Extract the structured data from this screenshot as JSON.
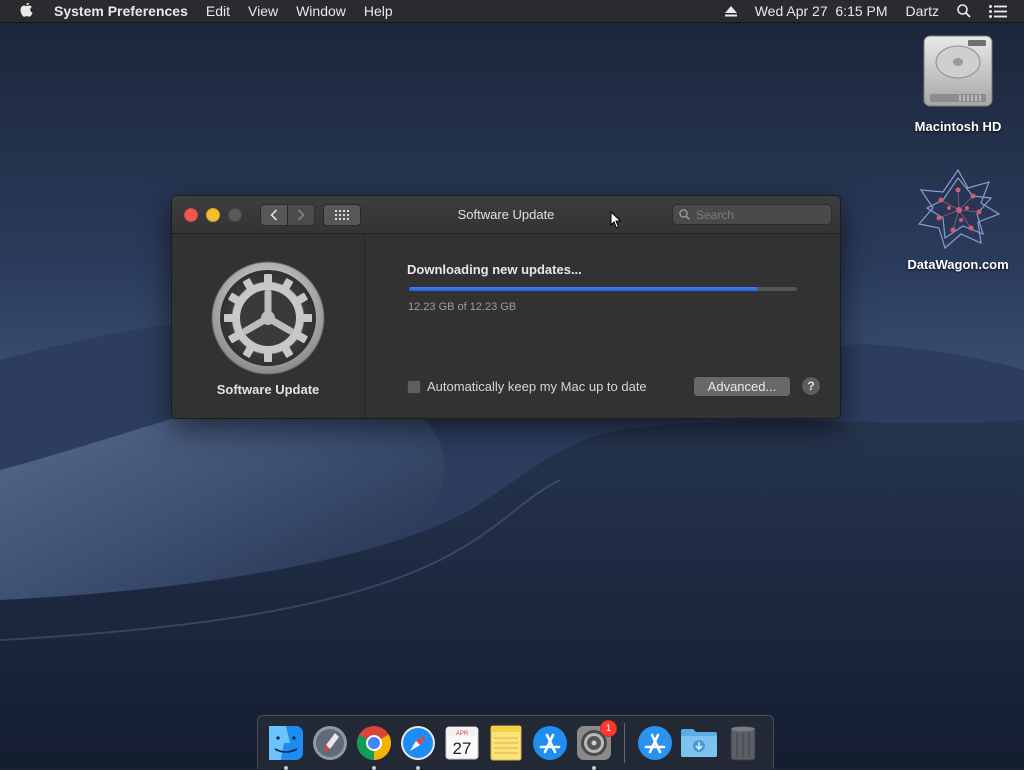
{
  "menubar": {
    "app_name": "System Preferences",
    "menus": [
      "Edit",
      "View",
      "Window",
      "Help"
    ],
    "datetime": "Wed Apr 27  6:15 PM",
    "user": "Dartz"
  },
  "desktop": {
    "icons": [
      {
        "label": "Macintosh HD"
      },
      {
        "label": "DataWagon.com"
      }
    ]
  },
  "window": {
    "title": "Software Update",
    "search_placeholder": "Search",
    "sidebar_label": "Software Update",
    "status": "Downloading new updates...",
    "progress_fraction": 0.9,
    "size_text": "12.23 GB of 12.23 GB",
    "auto_update_label": "Automatically keep my Mac up to date",
    "auto_update_checked": false,
    "advanced_label": "Advanced...",
    "help_label": "?"
  },
  "dock": {
    "calendar_month": "APR",
    "calendar_day": "27",
    "sysprefs_badge": "1",
    "items": [
      {
        "icon": "finder-icon",
        "running": true
      },
      {
        "icon": "launchpad-icon",
        "running": false
      },
      {
        "icon": "chrome-icon",
        "running": true
      },
      {
        "icon": "safari-icon",
        "running": true
      },
      {
        "icon": "calendar-icon",
        "running": false
      },
      {
        "icon": "notes-icon",
        "running": false
      },
      {
        "icon": "app-store-icon",
        "running": false
      },
      {
        "icon": "system-preferences-icon",
        "running": true
      },
      {
        "icon": "app-store-downloads-icon",
        "running": false
      },
      {
        "icon": "downloads-folder-icon",
        "running": false
      },
      {
        "icon": "trash-icon",
        "running": false
      }
    ]
  }
}
